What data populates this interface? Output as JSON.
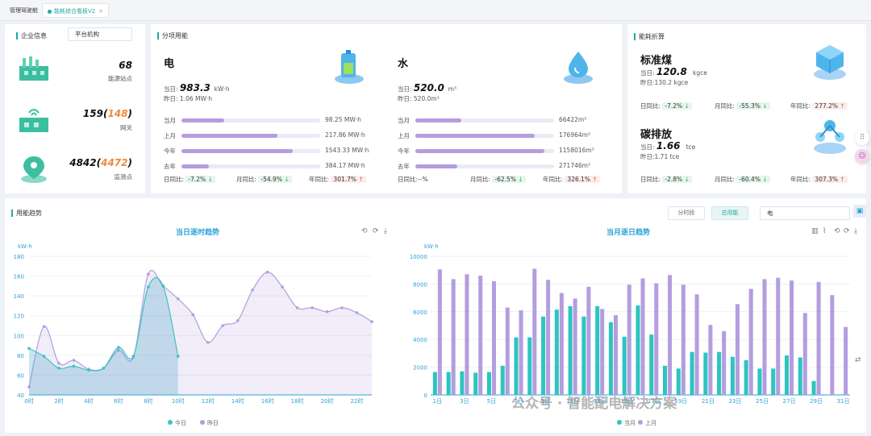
{
  "tabs": [
    {
      "label": "管理驾驶舱"
    },
    {
      "label": "能耗综合看板V2"
    }
  ],
  "enterprise": {
    "title": "企业信息",
    "org_select": "平台机构",
    "items": [
      {
        "value": "68",
        "label": "能源站点",
        "icon": "factory-icon"
      },
      {
        "value": "159",
        "extra": "148",
        "label": "网关",
        "icon": "gateway-icon"
      },
      {
        "value": "4842",
        "extra": "4472",
        "label": "监测点",
        "icon": "map-pin-icon"
      }
    ]
  },
  "sub_energy": {
    "title": "分项用能",
    "electric": {
      "name": "电",
      "today_label": "当日:",
      "today_value": "983.3",
      "unit": "kW·h",
      "yesterday": "昨日: 1.06 MW·h",
      "rows": [
        {
          "label": "当月",
          "value": "98.25 MW·h",
          "fill": 0.31
        },
        {
          "label": "上月",
          "value": "217.86 MW·h",
          "fill": 0.69
        },
        {
          "label": "今年",
          "value": "1543.33 MW·h",
          "fill": 0.8
        },
        {
          "label": "去年",
          "value": "384.17 MW·h",
          "fill": 0.2
        }
      ],
      "day_cmp_label": "日同比:",
      "day_cmp": "-7.2%",
      "day_dir": "down",
      "month_cmp_label": "月同比:",
      "month_cmp": "-54.9%",
      "month_dir": "down",
      "year_cmp_label": "年同比:",
      "year_cmp": "301.7%",
      "year_dir": "up"
    },
    "water": {
      "name": "水",
      "today_label": "当日:",
      "today_value": "520.0",
      "unit": "m³",
      "yesterday": "昨日: 520.0m³",
      "rows": [
        {
          "label": "当月",
          "value": "66422m³",
          "fill": 0.33
        },
        {
          "label": "上月",
          "value": "176964m³",
          "fill": 0.86
        },
        {
          "label": "今年",
          "value": "1158016m³",
          "fill": 0.93
        },
        {
          "label": "去年",
          "value": "271746m³",
          "fill": 0.3
        }
      ],
      "day_cmp_label": "日同比:",
      "day_cmp": "--%",
      "day_dir": "",
      "month_cmp_label": "月同比:",
      "month_cmp": "-62.5%",
      "month_dir": "down",
      "year_cmp_label": "年同比:",
      "year_cmp": "326.1%",
      "year_dir": "up"
    }
  },
  "conversion": {
    "title": "能耗折算",
    "coal": {
      "name": "标准煤",
      "today_label": "当日:",
      "today_value": "120.8",
      "unit": "kgce",
      "yesterday": "昨日:130.2 kgce",
      "day_cmp_label": "日同比:",
      "day_cmp": "-7.2%",
      "month_cmp_label": "月同比:",
      "month_cmp": "-55.3%",
      "year_cmp_label": "年同比:",
      "year_cmp": "277.2%"
    },
    "carbon": {
      "name": "碳排放",
      "today_label": "当日:",
      "today_value": "1.66",
      "unit": "tce",
      "yesterday": "昨日:1.71 tce",
      "day_cmp_label": "日同比:",
      "day_cmp": "-2.8%",
      "month_cmp_label": "月同比:",
      "month_cmp": "-60.4%",
      "year_cmp_label": "年同比:",
      "year_cmp": "307.3%"
    }
  },
  "trend": {
    "title": "用能趋势",
    "btn_period": "分时段",
    "btn_total": "总用能",
    "select_value": "电",
    "up_arrow": "↑",
    "down_arrow": "↓"
  },
  "colors": {
    "accent": "#1fa9a3",
    "today": "#3cc4c4",
    "yesterday": "#b49ddf",
    "title_blue": "#2aa2d6"
  },
  "watermark": "公众号 · 智能配电解决方案",
  "chart_data": [
    {
      "type": "area",
      "title": "当日逐时趋势",
      "ylabel": "kW·h",
      "ylim": [
        40,
        180
      ],
      "yticks": [
        40,
        60,
        80,
        100,
        120,
        140,
        160,
        180
      ],
      "categories": [
        "0时",
        "1时",
        "2时",
        "3时",
        "4时",
        "5时",
        "6时",
        "7时",
        "8时",
        "9时",
        "10时",
        "11时",
        "12时",
        "13时",
        "14时",
        "15时",
        "16时",
        "17时",
        "18时",
        "19时",
        "20时",
        "21时",
        "22时",
        "23时"
      ],
      "xtick_labels": [
        "0时",
        "2时",
        "4时",
        "6时",
        "8时",
        "10时",
        "12时",
        "14时",
        "16时",
        "18时",
        "20时",
        "22时"
      ],
      "series": [
        {
          "name": "今日",
          "values": [
            87,
            79,
            67,
            69,
            65,
            67,
            88,
            79,
            149,
            150,
            79
          ]
        },
        {
          "name": "昨日",
          "values": [
            48,
            109,
            72,
            75,
            66,
            67,
            85,
            78,
            162,
            150,
            137,
            121,
            93,
            110,
            115,
            146,
            164,
            149,
            128,
            128,
            124,
            128,
            123,
            114
          ]
        }
      ],
      "legend": "bottom",
      "grid": true
    },
    {
      "type": "bar",
      "title": "当月逐日趋势",
      "ylabel": "kW·h",
      "ylim": [
        0,
        10000
      ],
      "yticks": [
        0,
        2000,
        4000,
        6000,
        8000,
        10000
      ],
      "categories": [
        "1日",
        "2日",
        "3日",
        "4日",
        "5日",
        "6日",
        "7日",
        "8日",
        "9日",
        "10日",
        "11日",
        "12日",
        "13日",
        "14日",
        "15日",
        "16日",
        "17日",
        "18日",
        "19日",
        "20日",
        "21日",
        "22日",
        "23日",
        "24日",
        "25日",
        "26日",
        "27日",
        "28日",
        "29日",
        "30日",
        "31日"
      ],
      "xtick_labels": [
        "1日",
        "3日",
        "5日",
        "7日",
        "9日",
        "11日",
        "13日",
        "15日",
        "17日",
        "19日",
        "21日",
        "23日",
        "25日",
        "27日",
        "29日",
        "31日"
      ],
      "series": [
        {
          "name": "当月",
          "values": [
            1650,
            1650,
            1700,
            1600,
            1650,
            2100,
            4150,
            4150,
            5650,
            6150,
            6400,
            5650,
            6400,
            5250,
            4200,
            6450,
            4350,
            2100,
            1900,
            3100,
            3050,
            3100,
            2750,
            2500,
            1900,
            1900,
            2850,
            2700,
            1000,
            0,
            0
          ]
        },
        {
          "name": "上月",
          "values": [
            9050,
            8350,
            8700,
            8600,
            8200,
            6300,
            6100,
            9100,
            8300,
            7350,
            6950,
            7800,
            6200,
            5750,
            7950,
            8400,
            8050,
            8650,
            7950,
            7250,
            5050,
            4600,
            6550,
            7650,
            8350,
            8450,
            8250,
            5900,
            8150,
            7200,
            4900
          ]
        }
      ],
      "legend": "bottom",
      "grid": true
    }
  ]
}
